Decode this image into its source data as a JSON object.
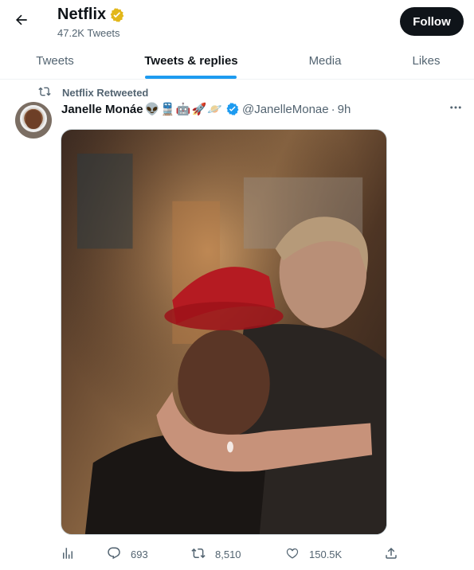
{
  "header": {
    "back_icon": "arrow-left-icon",
    "profile_name": "Netflix",
    "verified_badge_icon": "gold-verified-icon",
    "tweet_count": "47.2K Tweets",
    "follow_label": "Follow"
  },
  "tabs": [
    {
      "label": "Tweets",
      "active": false
    },
    {
      "label": "Tweets & replies",
      "active": true
    },
    {
      "label": "Media",
      "active": false
    },
    {
      "label": "Likes",
      "active": false
    }
  ],
  "tweet": {
    "retweet_context": "Netflix Retweeted",
    "retweet_icon": "retweet-icon",
    "author_name": "Janelle Monáe",
    "author_emojis": [
      "👽",
      "🚆",
      "🤖",
      "🚀",
      "🪐"
    ],
    "verified_icon": "blue-verified-icon",
    "handle": "@JanelleMonae",
    "separator": "·",
    "time": "9h",
    "more_icon": "more-icon",
    "image_icon": "photo",
    "actions": {
      "analytics_icon": "analytics-icon",
      "reply_icon": "reply-icon",
      "reply_count": "693",
      "retweet_icon": "retweet-icon",
      "retweet_count": "8,510",
      "like_icon": "heart-icon",
      "like_count": "150.5K",
      "share_icon": "share-icon"
    }
  },
  "colors": {
    "accent": "#1d9bf0",
    "text_primary": "#0f1419",
    "text_secondary": "#536471",
    "gold_badge": "#e2b719",
    "button_dark": "#0f1419"
  }
}
